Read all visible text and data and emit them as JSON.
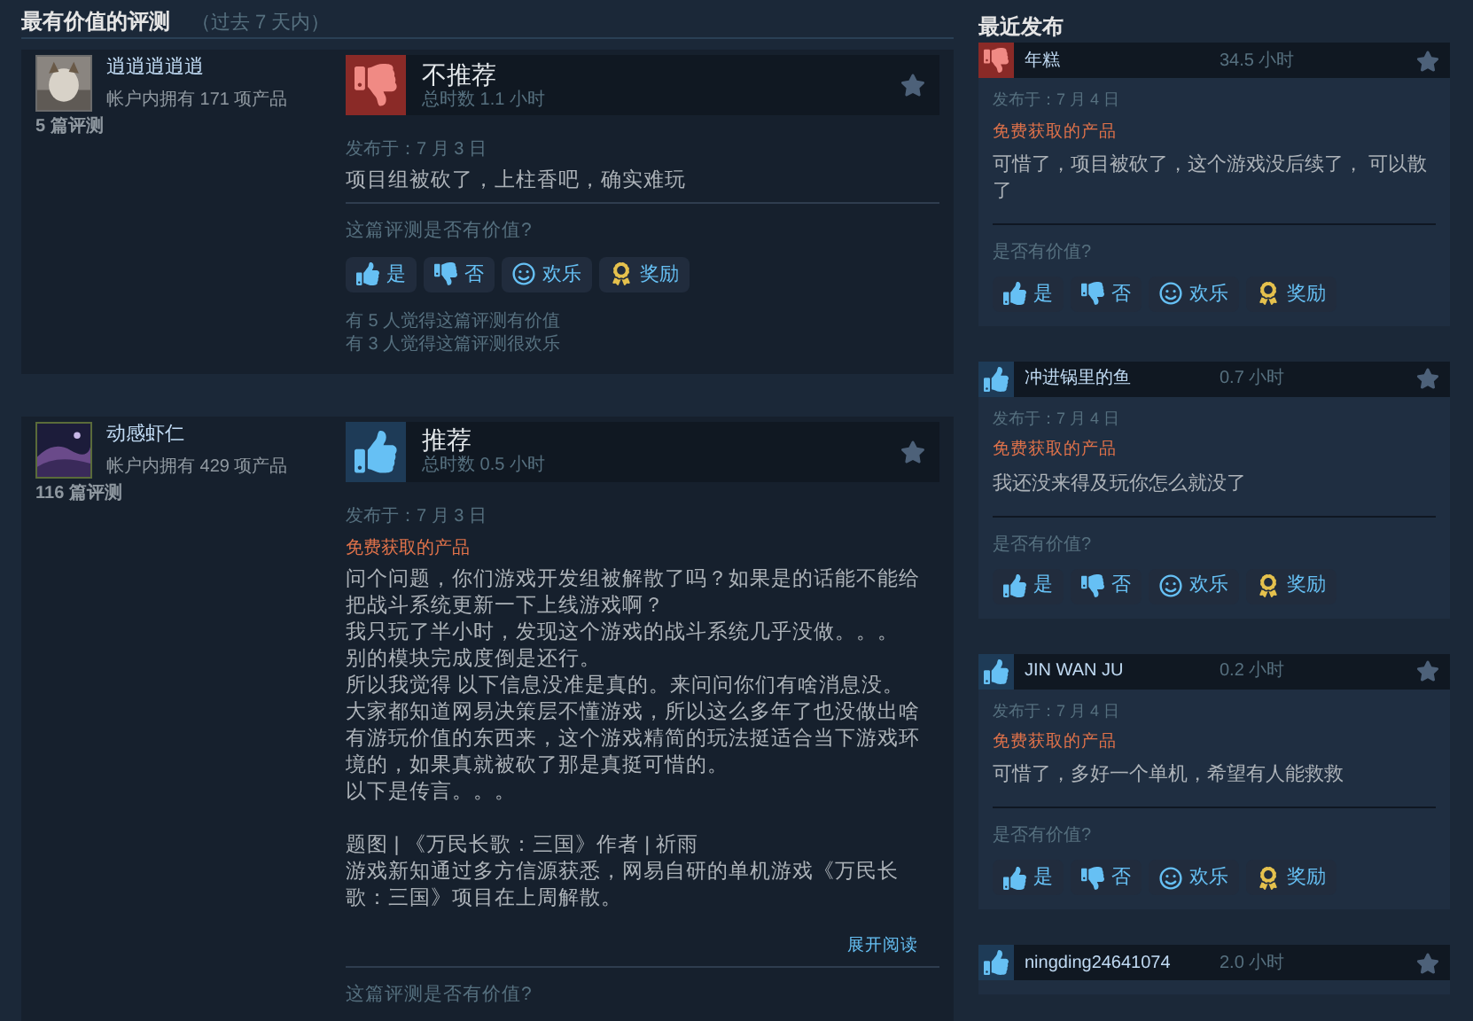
{
  "section_title": "最有价值的评测",
  "section_subtitle": "（过去 7 天内）",
  "top_reviews": [
    {
      "author": "逍逍逍逍逍",
      "products": "帐户内拥有 171 项产品",
      "review_count": "5 篇评测",
      "recommended": false,
      "verdict": "不推荐",
      "hours": "总时数 1.1 小时",
      "posted": "发布于：7 月 3 日",
      "paragraphs": [
        "项目组被砍了，上柱香吧，确实难玩"
      ],
      "helpful_prompt": "这篇评测是否有价值?",
      "buttons": [
        {
          "kind": "yes",
          "label": "是"
        },
        {
          "kind": "no",
          "label": "否"
        },
        {
          "kind": "funny",
          "label": "欢乐"
        },
        {
          "kind": "award",
          "label": "奖励"
        }
      ],
      "stats": [
        "有 5 人觉得这篇评测有价值",
        "有 3 人觉得这篇评测很欢乐"
      ]
    },
    {
      "author": "动感虾仁",
      "products": "帐户内拥有 429 项产品",
      "review_count": "116 篇评测",
      "recommended": true,
      "verdict": "推荐",
      "hours": "总时数 0.5 小时",
      "posted": "发布于：7 月 3 日",
      "free_product": "免费获取的产品",
      "paragraphs": [
        "问个问题，你们游戏开发组被解散了吗？如果是的话能不能给把战斗系统更新一下上线游戏啊？",
        "我只玩了半小时，发现这个游戏的战斗系统几乎没做。。。",
        "别的模块完成度倒是还行。",
        "所以我觉得 以下信息没准是真的。来问问你们有啥消息没。",
        "大家都知道网易决策层不懂游戏，所以这么多年了也没做出啥有游玩价值的东西来，这个游戏精简的玩法挺适合当下游戏环境的，如果真就被砍了那是真挺可惜的。",
        "以下是传言。。。",
        "题图 | 《万民长歌：三国》作者 | 祈雨",
        "游戏新知通过多方信源获悉，网易自研的单机游戏《万民长歌：三国》项目在上周解散。"
      ],
      "read_more": "展开阅读",
      "helpful_prompt": "这篇评测是否有价值?"
    }
  ],
  "recent_title": "最近发布",
  "recent_reviews": [
    {
      "author": "年糕",
      "recommended": false,
      "hours": "34.5 小时",
      "posted": "发布于：7 月 4 日",
      "free_product": "免费获取的产品",
      "text": "可惜了，项目被砍了，这个游戏没后续了， 可以散了",
      "helpful_prompt": "是否有价值?",
      "buttons": [
        {
          "kind": "yes",
          "label": "是"
        },
        {
          "kind": "no",
          "label": "否"
        },
        {
          "kind": "funny",
          "label": "欢乐"
        },
        {
          "kind": "award",
          "label": "奖励"
        }
      ]
    },
    {
      "author": "冲进锅里的鱼",
      "recommended": true,
      "hours": "0.7 小时",
      "posted": "发布于：7 月 4 日",
      "free_product": "免费获取的产品",
      "text": "我还没来得及玩你怎么就没了",
      "helpful_prompt": "是否有价值?",
      "buttons": [
        {
          "kind": "yes",
          "label": "是"
        },
        {
          "kind": "no",
          "label": "否"
        },
        {
          "kind": "funny",
          "label": "欢乐"
        },
        {
          "kind": "award",
          "label": "奖励"
        }
      ]
    },
    {
      "author": "JIN WAN JU",
      "recommended": true,
      "hours": "0.2 小时",
      "posted": "发布于：7 月 4 日",
      "free_product": "免费获取的产品",
      "text": "可惜了，多好一个单机，希望有人能救救",
      "helpful_prompt": "是否有价值?",
      "buttons": [
        {
          "kind": "yes",
          "label": "是"
        },
        {
          "kind": "no",
          "label": "否"
        },
        {
          "kind": "funny",
          "label": "欢乐"
        },
        {
          "kind": "award",
          "label": "奖励"
        }
      ]
    },
    {
      "author": "ningding24641074",
      "recommended": true,
      "hours": "2.0 小时"
    }
  ]
}
